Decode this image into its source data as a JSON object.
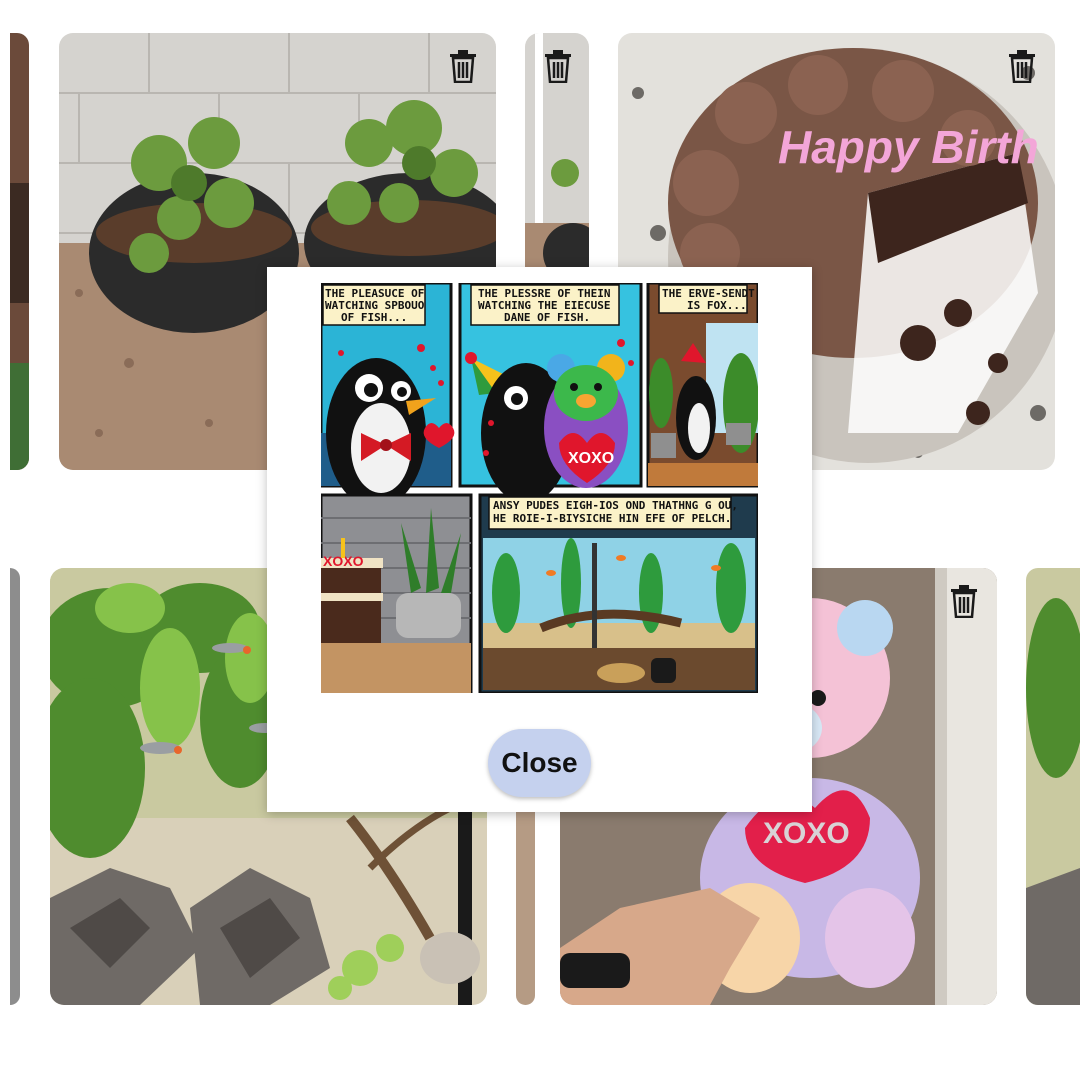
{
  "gallery": {
    "photos": [
      {
        "subject": "potted plants on gravel",
        "delete_icon": "trash-icon"
      },
      {
        "subject": "chocolate birthday cake",
        "cake_text": "Happy Birth",
        "delete_icon": "trash-icon"
      },
      {
        "subject": "aquarium with fish and driftwood"
      },
      {
        "subject": "pink tie-dye teddy bear",
        "heart_text": "XOXO",
        "delete_icon": "trash-icon"
      }
    ]
  },
  "modal": {
    "comic": {
      "panel1_caption_1": "THE PLEASUCE OF",
      "panel1_caption_2": "WATCHING SPBOUO",
      "panel1_caption_3": "OF FISH...",
      "panel2_caption_1": "THE PLESSRE OF THEIN",
      "panel2_caption_2": "WATCHING THE EIECUSE",
      "panel2_caption_3": "DANE OF FISH.",
      "panel3_caption_1": "THE ERVE-SENDT",
      "panel3_caption_2": "IS FOX...",
      "panel5_caption_1": "ANSY PUDES EIGH-IOS OND THATHNG G OU,",
      "panel5_caption_2": "HE ROIE-I-BIYSICHE HIN EFE OF PELCH.",
      "bear_heart_text": "XOXO",
      "cake_text": "XOXO"
    },
    "close_label": "Close"
  }
}
